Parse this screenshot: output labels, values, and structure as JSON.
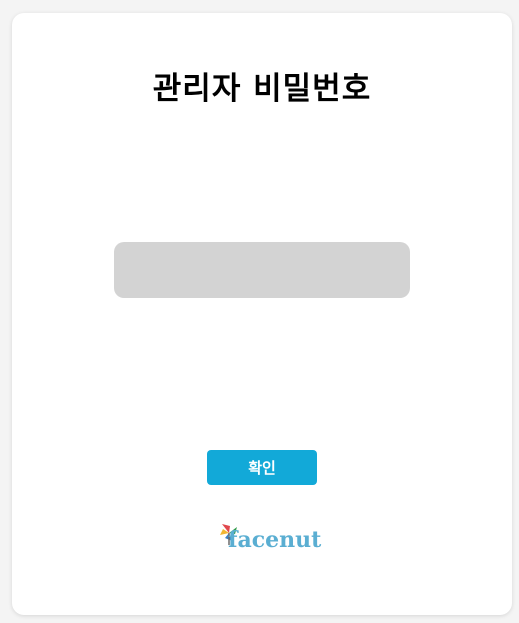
{
  "dialog": {
    "title": "관리자 비밀번호",
    "password_input": {
      "value": "",
      "placeholder": ""
    },
    "confirm_label": "확인"
  },
  "brand": {
    "logo_text": "facenut",
    "logo_icon": "pinwheel-logo-icon"
  },
  "colors": {
    "accent": "#12a9d8",
    "input_bg": "#d3d3d3",
    "logo_text": "#5aaed2"
  }
}
